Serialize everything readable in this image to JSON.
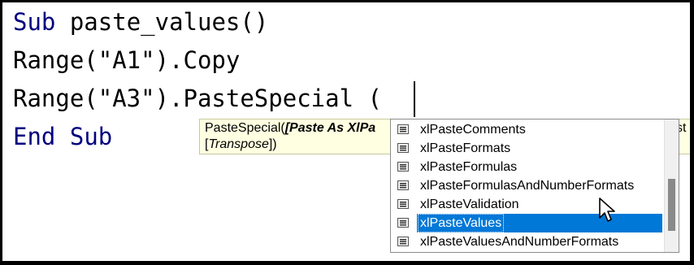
{
  "code": {
    "line1": {
      "kw": "Sub",
      "rest": " paste_values()"
    },
    "line2": "Range(\"A1\").Copy",
    "line3": "Range(\"A3\").PasteSpecial (",
    "line4": {
      "kw1": "End",
      "kw2": "Sub"
    }
  },
  "tooltip": {
    "prefix": "PasteSpecial(",
    "bold_param": "[Paste As XlPa",
    "line2_open": "[",
    "transpose": "Transpose",
    "line2_close": "])",
    "tail": "st"
  },
  "autocomplete": {
    "items": [
      {
        "label": "xlPasteComments",
        "icon": "enum-member-icon"
      },
      {
        "label": "xlPasteFormats",
        "icon": "enum-member-icon"
      },
      {
        "label": "xlPasteFormulas",
        "icon": "enum-member-icon"
      },
      {
        "label": "xlPasteFormulasAndNumberFormats",
        "icon": "enum-member-icon"
      },
      {
        "label": "xlPasteValidation",
        "icon": "enum-member-icon"
      },
      {
        "label": "xlPasteValues",
        "icon": "enum-member-icon",
        "selected": true
      },
      {
        "label": "xlPasteValuesAndNumberFormats",
        "icon": "enum-member-icon"
      }
    ]
  },
  "colors": {
    "keyword": "#00007f",
    "selection": "#0078d7",
    "tooltip_bg": "#ffffe1"
  }
}
